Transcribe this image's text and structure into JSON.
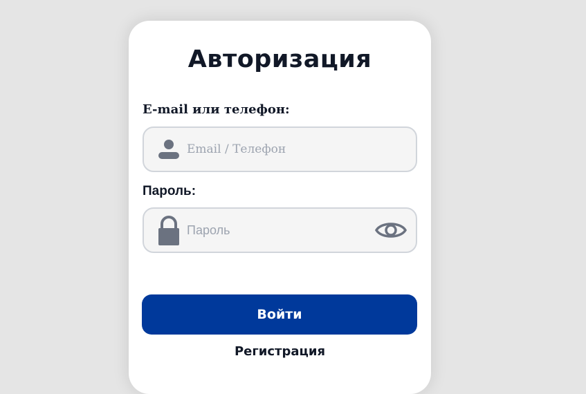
{
  "form": {
    "title": "Авторизация",
    "email_label": "E-mail или телефон:",
    "email_placeholder": "Email / Телефон",
    "password_label": "Пароль:",
    "password_placeholder": "Пароль",
    "login_button": "Войти",
    "register_link": "Регистрация"
  },
  "icons": {
    "email_field": "user-icon",
    "password_field": "lock-icon",
    "password_toggle": "eye-icon"
  },
  "colors": {
    "primary": "#00399b",
    "text": "#111827",
    "icon": "#6b7280",
    "placeholder": "#9ca3af",
    "field_bg": "#f5f5f5",
    "field_border": "#d1d5db",
    "page_bg": "#e5e5e5"
  }
}
